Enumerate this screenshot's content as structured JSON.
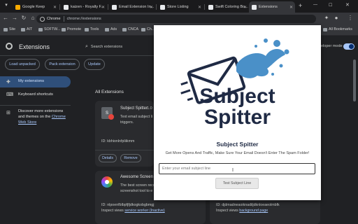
{
  "tabs": [
    {
      "title": "Google Keep",
      "favicon_color": "#f9ab00"
    },
    {
      "title": "kaizen - Royalty F...",
      "favicon_color": "#e8eaed"
    },
    {
      "title": "Email Extension In...",
      "favicon_color": "#e8eaed"
    },
    {
      "title": "Store Listing",
      "favicon_color": "#e8eaed"
    },
    {
      "title": "Swift Coloring Bo...",
      "favicon_color": "#e8eaed"
    },
    {
      "title": "Extensions",
      "favicon_color": "#e8eaed"
    }
  ],
  "new_tab_symbol": "+",
  "omnibox": {
    "chip": "Chrome",
    "url": "chrome://extensions"
  },
  "bookmarks": {
    "items": [
      "Site",
      "AIT",
      "SOFTW...",
      "Promote",
      "Tools",
      "Ads",
      "CNCA",
      "Ch..."
    ],
    "all_bookmarks": "All Bookmarks"
  },
  "extensions_page": {
    "title": "Extensions",
    "search_placeholder": "Search extensions",
    "developer_mode": "eloper mode",
    "buttons": {
      "load_unpacked": "Load unpacked",
      "pack_extension": "Pack extension",
      "update": "Update"
    },
    "sidebar": {
      "my_extensions": "My extensions",
      "keyboard_shortcuts": "Keyboard shortcuts",
      "discover_text": "Discover more extensions and themes on the ",
      "discover_link": "Chrome Web Store"
    },
    "section_title": "All Extensions",
    "cards": [
      {
        "name": "Subject Spitter",
        "version": "1.0",
        "desc_1": "Text email subject li",
        "desc_2": "triggers.",
        "id": "ID: kbhionlnfpliikmm",
        "details": "Details",
        "remove": "Remove"
      },
      {
        "name": "Awesome Screen Re",
        "desc_1": "The best screen recc",
        "desc_2": "screenshot tool to e",
        "id": "ID: nlpoenfblbpfjfjdkogkobgbmgj",
        "inspect_prefix": "Inspect views ",
        "inspect_link": "service worker (Inactive)"
      },
      {
        "id": "ID: djdmadneaoiknadiljdknloeaeolmbfk",
        "inspect_prefix": "Inspect views ",
        "inspect_link": "background page"
      }
    ]
  },
  "popup": {
    "logo_line1": "Subject",
    "logo_line2": "Spitter",
    "title": "Subject Spitter",
    "subtitle": "Get More Opens And Traffic, Make Sure Your Email Doesn't Enter The Spam Folder!",
    "input_placeholder": "Enter your email subject line",
    "button_label": "Test Subject Line"
  }
}
